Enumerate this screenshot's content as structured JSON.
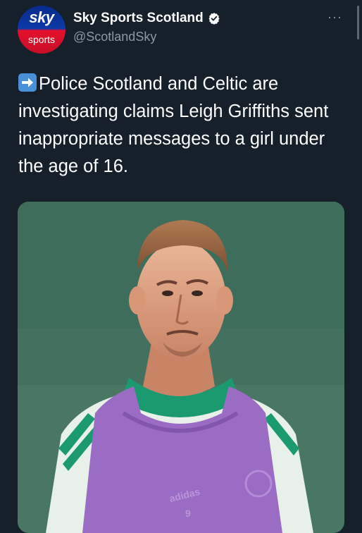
{
  "account": {
    "avatar_top": "sky",
    "avatar_bottom": "sports",
    "display_name": "Sky Sports Scotland",
    "handle": "@ScotlandSky",
    "verified_icon": "verified-badge-icon",
    "more_label": "···"
  },
  "tweet": {
    "emoji_icon": "right-arrow-emoji-icon",
    "text": "Police Scotland and Celtic are investigating claims Leigh Griffiths sent inappropriate messages to a girl under the age of 16."
  },
  "media": {
    "bib_brand": "adidas",
    "bib_number": "9"
  },
  "colors": {
    "background": "#15202b",
    "primary_text": "#ffffff",
    "secondary_text": "#8b98a5",
    "bib_purple": "#9a6cc4",
    "kit_green": "#1a9a6e"
  }
}
